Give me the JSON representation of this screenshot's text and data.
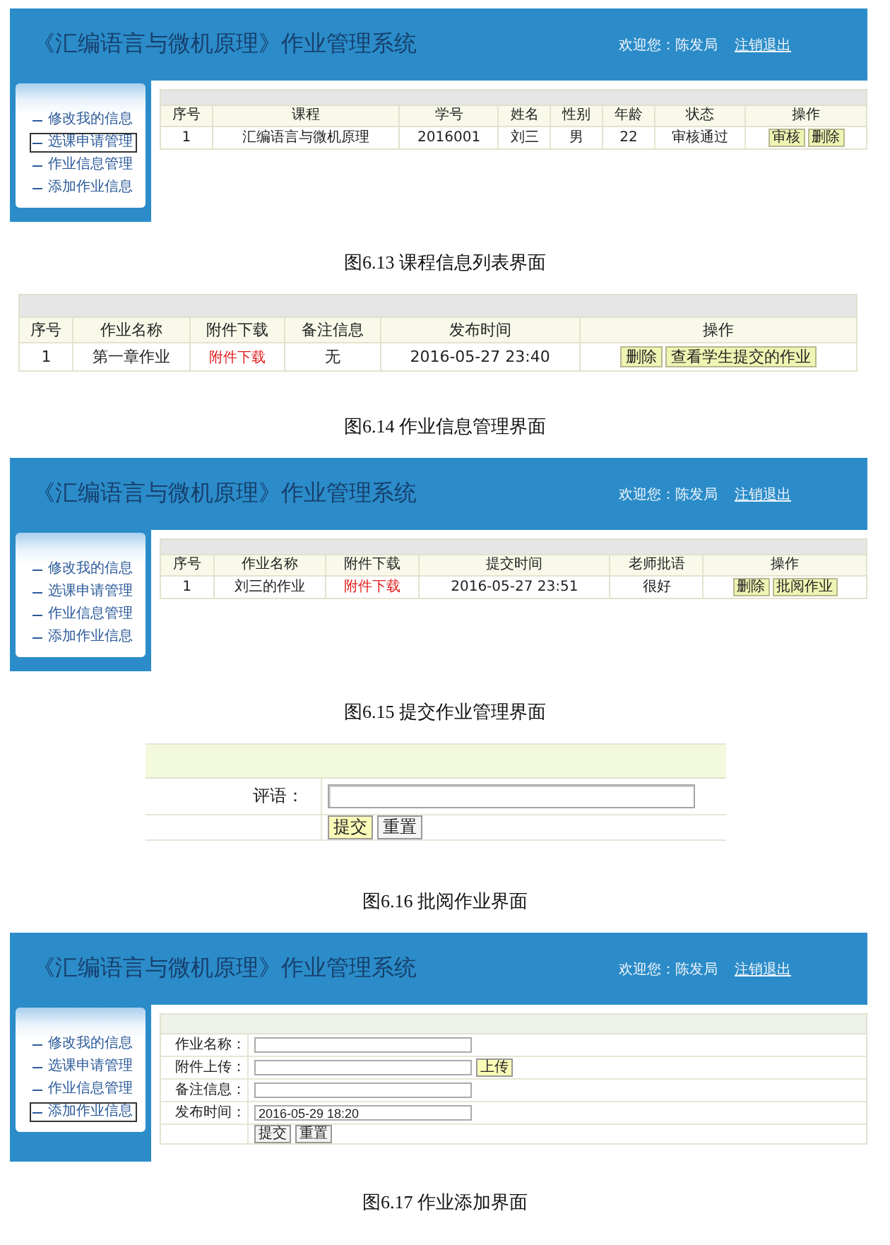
{
  "figures": [
    {
      "kind": "app_window",
      "header": {
        "title": "《汇编语言与微机原理》作业管理系统",
        "welcome": "欢迎您：陈发局",
        "logout": "注销退出"
      },
      "sidebar": {
        "items": [
          {
            "label": "修改我的信息",
            "selected": false
          },
          {
            "label": "选课申请管理",
            "selected": true
          },
          {
            "label": "作业信息管理",
            "selected": false
          },
          {
            "label": "添加作业信息",
            "selected": false
          }
        ]
      },
      "content": {
        "kind": "table",
        "columns": [
          "序号",
          "课程",
          "学号",
          "姓名",
          "性别",
          "年龄",
          "状态",
          "操作"
        ],
        "rows": [
          {
            "cells": [
              {
                "kind": "text",
                "text": "1"
              },
              {
                "kind": "text",
                "text": "汇编语言与微机原理"
              },
              {
                "kind": "text",
                "text": "2016001"
              },
              {
                "kind": "text",
                "text": "刘三"
              },
              {
                "kind": "text",
                "text": "男"
              },
              {
                "kind": "text",
                "text": "22"
              },
              {
                "kind": "text",
                "text": "审核通过"
              }
            ],
            "actions": [
              "审核",
              "删除"
            ]
          }
        ]
      },
      "caption": "图6.13 课程信息列表界面"
    },
    {
      "kind": "table_panel",
      "content": {
        "kind": "table",
        "columns": [
          "序号",
          "作业名称",
          "附件下载",
          "备注信息",
          "发布时间",
          "操作"
        ],
        "rows": [
          {
            "cells": [
              {
                "kind": "text",
                "text": "1"
              },
              {
                "kind": "text",
                "text": "第一章作业"
              },
              {
                "kind": "link",
                "text": "附件下载"
              },
              {
                "kind": "text",
                "text": "无"
              },
              {
                "kind": "text",
                "text": "2016-05-27 23:40"
              }
            ],
            "actions": [
              "删除",
              "查看学生提交的作业"
            ]
          }
        ]
      },
      "caption": "图6.14 作业信息管理界面"
    },
    {
      "kind": "app_window",
      "header": {
        "title": "《汇编语言与微机原理》作业管理系统",
        "welcome": "欢迎您：陈发局",
        "logout": "注销退出"
      },
      "sidebar": {
        "items": [
          {
            "label": "修改我的信息",
            "selected": false
          },
          {
            "label": "选课申请管理",
            "selected": false
          },
          {
            "label": "作业信息管理",
            "selected": false
          },
          {
            "label": "添加作业信息",
            "selected": false
          }
        ]
      },
      "content": {
        "kind": "table",
        "columns": [
          "序号",
          "作业名称",
          "附件下载",
          "提交时间",
          "老师批语",
          "操作"
        ],
        "rows": [
          {
            "cells": [
              {
                "kind": "text",
                "text": "1"
              },
              {
                "kind": "text",
                "text": "刘三的作业"
              },
              {
                "kind": "link",
                "text": "附件下载"
              },
              {
                "kind": "text",
                "text": "2016-05-27 23:51"
              },
              {
                "kind": "text",
                "text": "很好"
              }
            ],
            "actions": [
              "删除",
              "批阅作业"
            ]
          }
        ]
      },
      "caption": "图6.15 提交作业管理界面"
    },
    {
      "kind": "form_panel",
      "content": {
        "kind": "form",
        "rows": [
          {
            "kind": "input",
            "label": "评语："
          },
          {
            "kind": "buttons",
            "buttons": [
              {
                "label": "提交",
                "highlighted": true
              },
              {
                "label": "重置",
                "highlighted": false
              }
            ]
          }
        ]
      },
      "caption": "图6.16 批阅作业界面"
    },
    {
      "kind": "app_window",
      "header": {
        "title": "《汇编语言与微机原理》作业管理系统",
        "welcome": "欢迎您：陈发局",
        "logout": "注销退出"
      },
      "sidebar": {
        "items": [
          {
            "label": "修改我的信息",
            "selected": false
          },
          {
            "label": "选课申请管理",
            "selected": false
          },
          {
            "label": "作业信息管理",
            "selected": false
          },
          {
            "label": "添加作业信息",
            "selected": true
          }
        ]
      },
      "content": {
        "kind": "form",
        "rows": [
          {
            "kind": "input",
            "label": "作业名称："
          },
          {
            "kind": "input",
            "label": "附件上传：",
            "upload_button": {
              "label": "上传",
              "highlighted": true
            }
          },
          {
            "kind": "input",
            "label": "备注信息："
          },
          {
            "kind": "input",
            "label": "发布时间：",
            "value": "2016-05-29 18:20"
          },
          {
            "kind": "buttons",
            "buttons": [
              {
                "label": "提交",
                "highlighted": false
              },
              {
                "label": "重置",
                "highlighted": false
              }
            ]
          }
        ]
      },
      "caption": "图6.17 作业添加界面"
    }
  ]
}
